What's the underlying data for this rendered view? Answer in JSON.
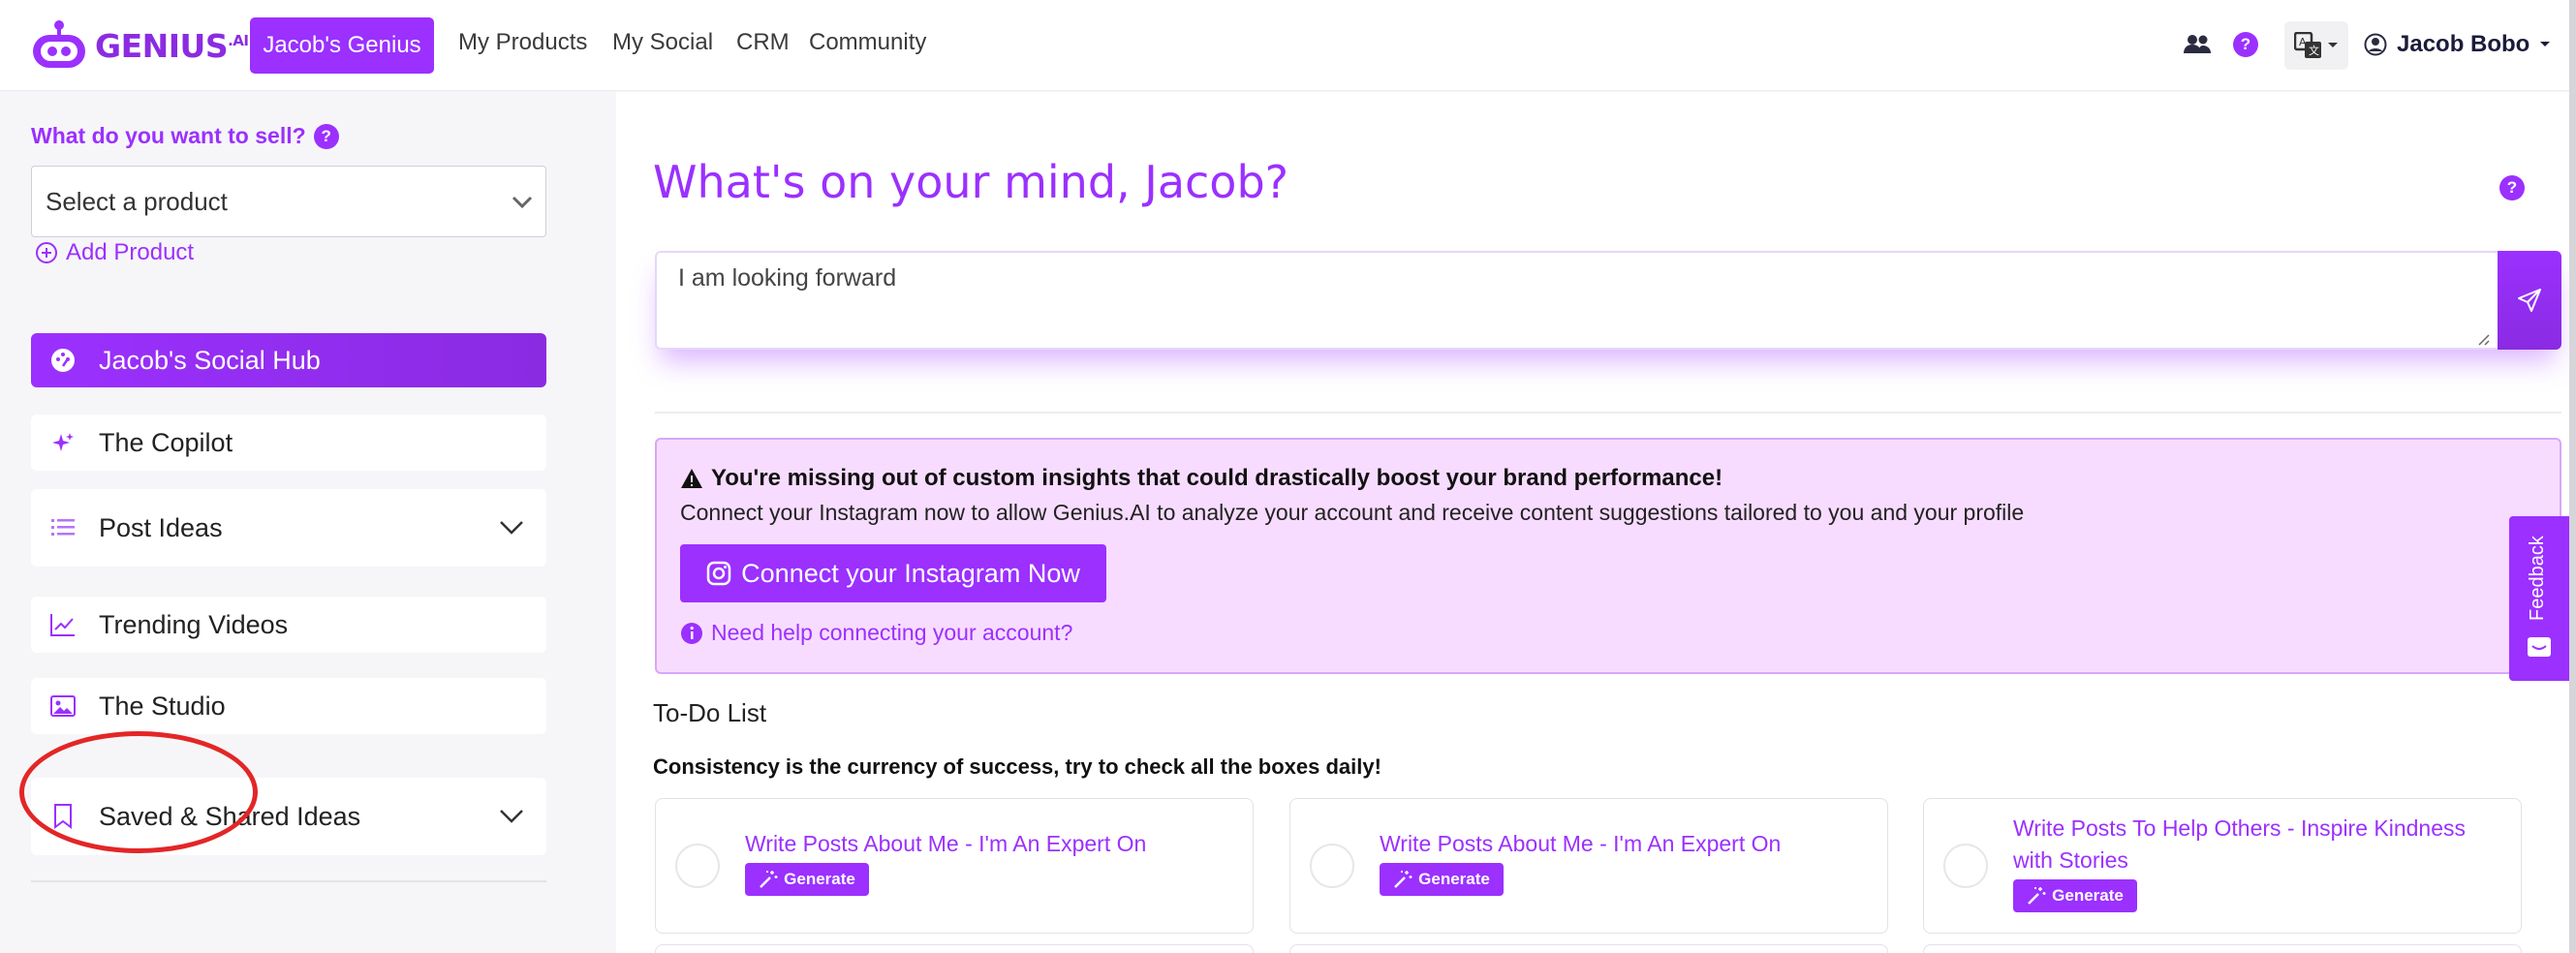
{
  "brand": {
    "name": "GENIUS",
    "suffix": ".AI",
    "accent": "#9b30ff"
  },
  "nav": {
    "active": "Jacob's Genius",
    "links": [
      "My Products",
      "My Social",
      "CRM",
      "Community"
    ],
    "user": "Jacob Bobo"
  },
  "sidebar": {
    "sell_label": "What do you want to sell?",
    "select_placeholder": "Select a product",
    "add_product": "Add Product",
    "items": [
      {
        "label": "Jacob's Social Hub",
        "icon": "dashboard-icon",
        "active": true
      },
      {
        "label": "The Copilot",
        "icon": "sparkle-icon"
      },
      {
        "label": "Post Ideas",
        "icon": "list-icon",
        "expandable": true
      },
      {
        "label": "Trending Videos",
        "icon": "trend-icon"
      },
      {
        "label": "The Studio",
        "icon": "image-icon"
      },
      {
        "label": "Saved & Shared Ideas",
        "icon": "bookmark-icon",
        "expandable": true
      }
    ]
  },
  "main": {
    "heading": "What's on your mind, Jacob?",
    "compose_value": "I am looking forward",
    "alert": {
      "title": "You're missing out of custom insights that could drastically boost your brand performance!",
      "body": "Connect your Instagram now to allow Genius.AI to analyze your account and receive content suggestions tailored to you and your profile",
      "button": "Connect your Instagram Now",
      "help": "Need help connecting your account?"
    },
    "todo": {
      "title": "To-Do List",
      "subtitle": "Consistency is the currency of success, try to check all the boxes daily!",
      "generate_label": "Generate",
      "cards": [
        {
          "title": "Write Posts About Me - I'm An Expert On"
        },
        {
          "title": "Write Posts About Me - I'm An Expert On"
        },
        {
          "title": "Write Posts To Help Others - Inspire Kindness with Stories"
        }
      ]
    },
    "feedback": "Feedback"
  }
}
